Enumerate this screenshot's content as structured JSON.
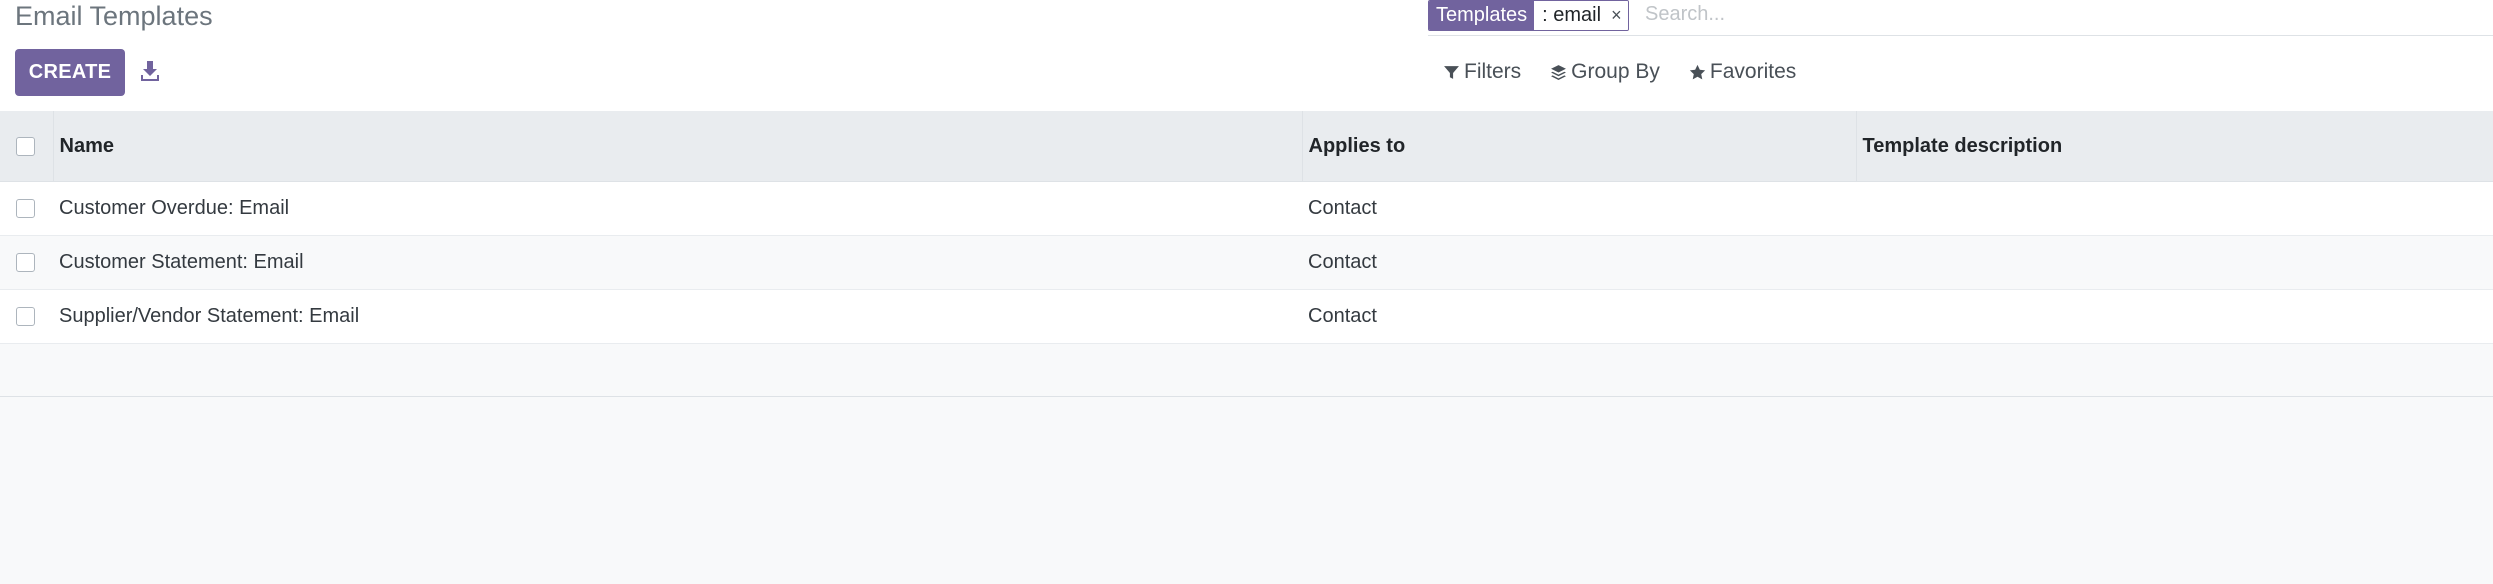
{
  "page": {
    "title": "Email Templates"
  },
  "toolbar": {
    "create_label": "CREATE",
    "download_icon": "download-icon"
  },
  "search": {
    "facet_category": "Templates",
    "facet_value": ": email",
    "facet_remove": "×",
    "placeholder": "Search..."
  },
  "search_options": {
    "filters_label": "Filters",
    "group_by_label": "Group By",
    "favorites_label": "Favorites"
  },
  "table": {
    "columns": [
      "Name",
      "Applies to",
      "Template description"
    ],
    "rows": [
      {
        "name": "Customer Overdue: Email",
        "applies_to": "Contact",
        "description": ""
      },
      {
        "name": "Customer Statement: Email",
        "applies_to": "Contact",
        "description": ""
      },
      {
        "name": "Supplier/Vendor Statement: Email",
        "applies_to": "Contact",
        "description": ""
      }
    ]
  },
  "colors": {
    "brand": "#71639e",
    "header_bg": "#e9ecef",
    "page_bg": "#f8f9fa"
  }
}
